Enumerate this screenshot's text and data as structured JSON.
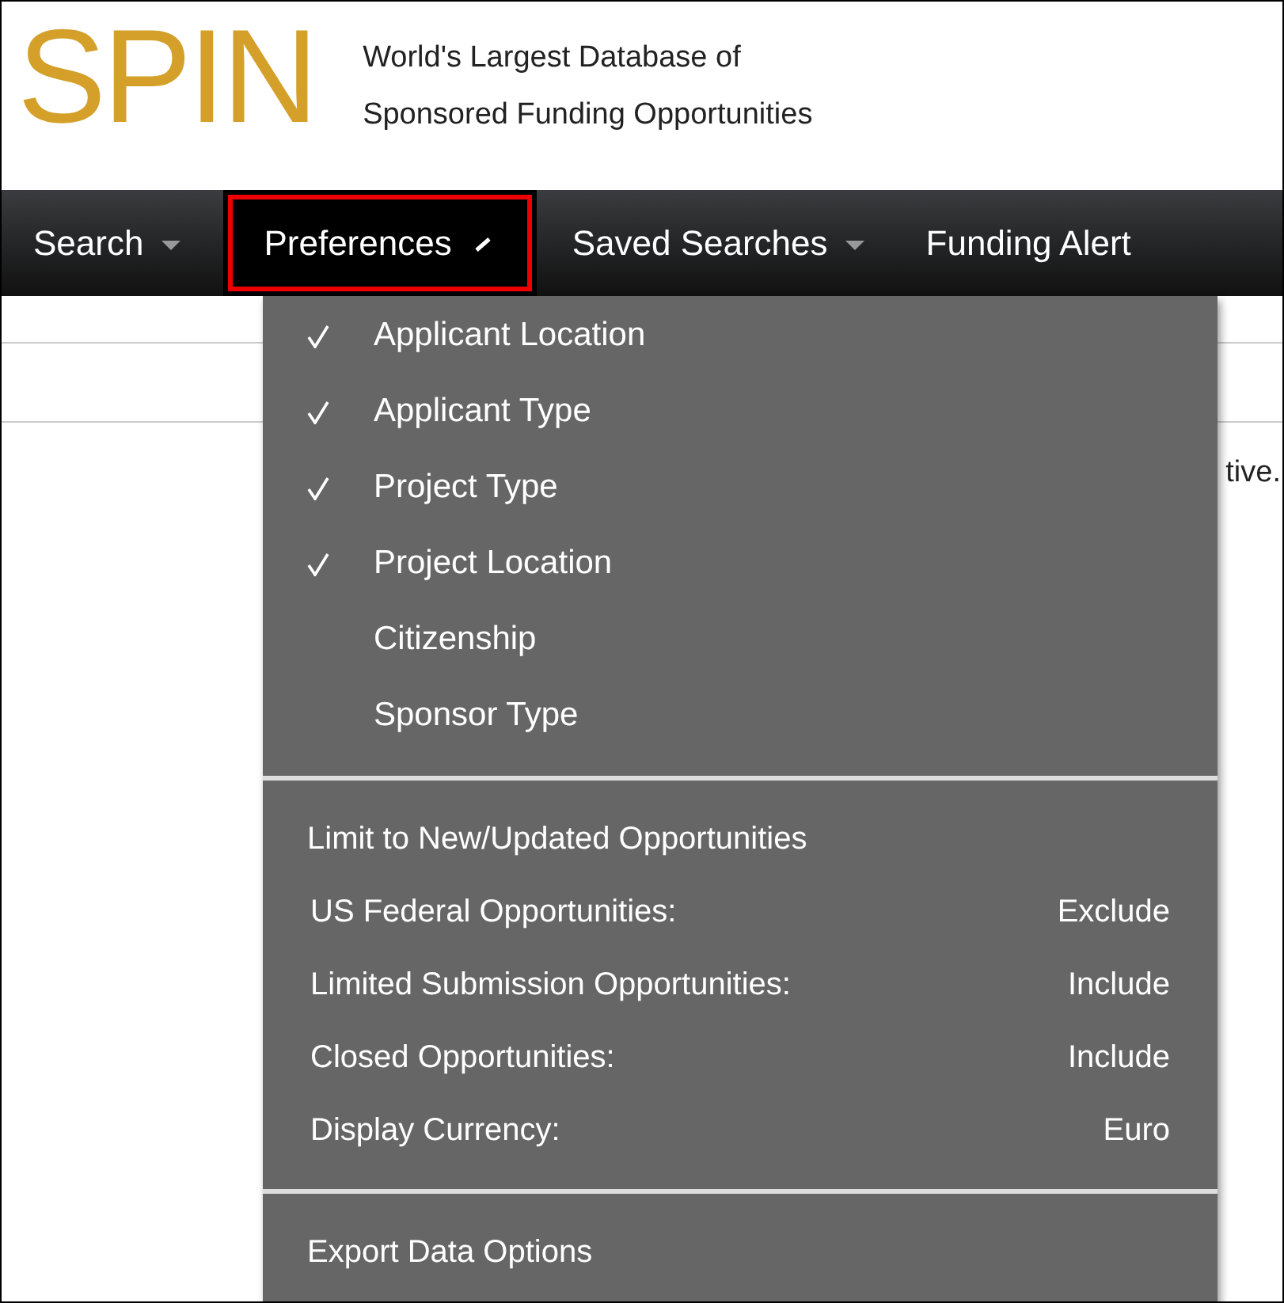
{
  "header": {
    "logo": "SPIN",
    "tagline_lines": [
      "World's Largest Database of",
      "Sponsored Funding Opportunities"
    ]
  },
  "nav": [
    {
      "label": "Search",
      "selected": false,
      "caret": true
    },
    {
      "label": "Preferences",
      "selected": true,
      "caret": true
    },
    {
      "label": "Saved Searches",
      "selected": false,
      "caret": true
    },
    {
      "label": "Funding Alert",
      "selected": false,
      "caret": false
    }
  ],
  "background_text": "tive.",
  "menu": {
    "sections": [
      [
        {
          "kind": "check",
          "label": "Applicant Location",
          "checked": true
        },
        {
          "kind": "check",
          "label": "Applicant Type",
          "checked": true
        },
        {
          "kind": "check",
          "label": "Project Type",
          "checked": true
        },
        {
          "kind": "check",
          "label": "Project Location",
          "checked": true
        },
        {
          "kind": "check",
          "label": "Citizenship",
          "checked": false
        },
        {
          "kind": "check",
          "label": "Sponsor Type",
          "checked": false
        }
      ],
      [
        {
          "kind": "link",
          "label": "Limit to New/Updated Opportunities"
        },
        {
          "kind": "option",
          "label": "US Federal Opportunities:",
          "value": "Exclude"
        },
        {
          "kind": "option",
          "label": "Limited Submission Opportunities:",
          "value": "Include"
        },
        {
          "kind": "option",
          "label": "Closed Opportunities:",
          "value": "Include"
        },
        {
          "kind": "option",
          "label": "Display Currency:",
          "value": "Euro"
        }
      ],
      [
        {
          "kind": "link",
          "label": "Export Data Options"
        }
      ]
    ]
  }
}
